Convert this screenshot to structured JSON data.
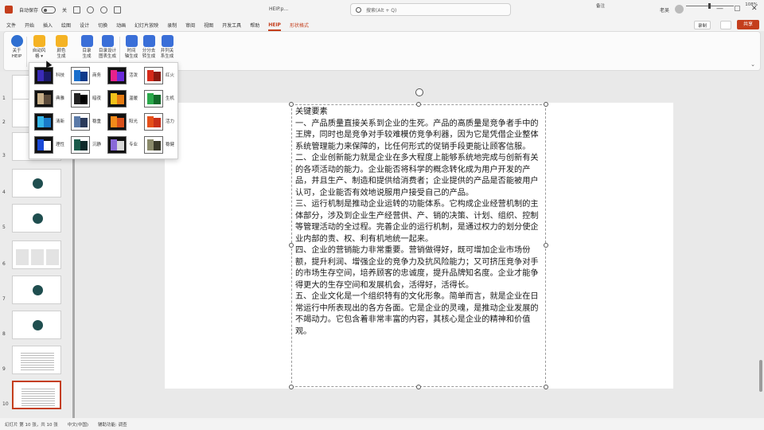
{
  "titlebar": {
    "autosave_label": "自动保存",
    "autosave_state": "关",
    "doc_title": "HEIP.p...",
    "search_placeholder": "搜索(Alt + Q)",
    "user_name": "老吴",
    "minimize": "—",
    "maximize": "▢",
    "close": "✕"
  },
  "menu": {
    "items": [
      "文件",
      "开始",
      "插入",
      "绘图",
      "设计",
      "切换",
      "动画",
      "幻灯片放映",
      "录制",
      "审阅",
      "视图",
      "开发工具",
      "帮助",
      "HEIP",
      "形状格式"
    ],
    "active_index": 13,
    "contextual_index": 14,
    "record_label": "录制",
    "comment_icon": "comment-icon",
    "share_label": "共享"
  },
  "ribbon": {
    "buttons": [
      {
        "label": "关于\nHEIP",
        "icon": "heip-logo-icon",
        "color": "#2f6fd1"
      },
      {
        "label": "自动风\n格 ▾",
        "icon": "paint-bucket-icon",
        "color": "#f5b324"
      },
      {
        "label": "颜色\n生成",
        "icon": "layers-icon",
        "color": "#f5b324"
      },
      {
        "label": "目录\n生成",
        "icon": "list-icon",
        "color": "#3a6fd8"
      },
      {
        "label": "目录设计\n图表生成",
        "icon": "grid-list-icon",
        "color": "#3a6fd8"
      },
      {
        "label": "时间\n轴生成",
        "icon": "wave-icon",
        "color": "#3a6fd8"
      },
      {
        "label": "分分去\n转生成",
        "icon": "network-icon",
        "color": "#3a6fd8"
      },
      {
        "label": "并列关\n系生成",
        "icon": "grid-icon",
        "color": "#3a6fd8"
      }
    ]
  },
  "themes": [
    {
      "name": "科技",
      "frame": "#111111",
      "c1": "#3a2bb8",
      "c2": "#1a1a66"
    },
    {
      "name": "商务",
      "frame": "#ffffff",
      "c1": "#1a6fcc",
      "c2": "#0f3a8a"
    },
    {
      "name": "活泼",
      "frame": "#111111",
      "c1": "#e6228a",
      "c2": "#6a2bd8"
    },
    {
      "name": "红火",
      "frame": "#ffffff",
      "c1": "#d62a1a",
      "c2": "#8a1a10"
    },
    {
      "name": "典雅",
      "frame": "#111111",
      "c1": "#c8b08a",
      "c2": "#5a4a3a"
    },
    {
      "name": "暗夜",
      "frame": "#ffffff",
      "c1": "#222222",
      "c2": "#000000"
    },
    {
      "name": "温暖",
      "frame": "#111111",
      "c1": "#f2c21a",
      "c2": "#e67b12"
    },
    {
      "name": "生机",
      "frame": "#ffffff",
      "c1": "#2aa84a",
      "c2": "#126a2a"
    },
    {
      "name": "清新",
      "frame": "#111111",
      "c1": "#36b6e8",
      "c2": "#1a7ac8"
    },
    {
      "name": "稳重",
      "frame": "#ffffff",
      "c1": "#5a7aa8",
      "c2": "#2a3a5a"
    },
    {
      "name": "阳光",
      "frame": "#111111",
      "c1": "#f28a1a",
      "c2": "#d8501a"
    },
    {
      "name": "活力",
      "frame": "#ffffff",
      "c1": "#e6501a",
      "c2": "#c8301a"
    },
    {
      "name": "理性",
      "frame": "#111111",
      "c1": "#1a4ad8",
      "c2": "#ffffff"
    },
    {
      "name": "沉静",
      "frame": "#ffffff",
      "c1": "#1a5a4a",
      "c2": "#0f2a2a"
    },
    {
      "name": "专业",
      "frame": "#111111",
      "c1": "#8a6ad8",
      "c2": "#d8d8d8"
    },
    {
      "name": "稳健",
      "frame": "#ffffff",
      "c1": "#8a8a6a",
      "c2": "#3a3a2a"
    }
  ],
  "thumbnails": [
    {
      "num": "1",
      "kind": "blank"
    },
    {
      "num": "2",
      "kind": "blank"
    },
    {
      "num": "3",
      "kind": "blank"
    },
    {
      "num": "4",
      "kind": "ring"
    },
    {
      "num": "5",
      "kind": "ring"
    },
    {
      "num": "6",
      "kind": "boxes"
    },
    {
      "num": "7",
      "kind": "ring"
    },
    {
      "num": "8",
      "kind": "ring"
    },
    {
      "num": "9",
      "kind": "lines"
    },
    {
      "num": "10",
      "kind": "lines"
    }
  ],
  "slide": {
    "paragraphs": [
      "关键要素",
      "一、产品质量直接关系到企业的生死。产品的高质量是竞争者手中的王牌，同时也是竞争对手较难模仿竞争利器，因为它是凭借企业整体系统管理能力来保障的，比任何形式的促销手段更能让顾客信服。",
      "二、企业创新能力就是企业在多大程度上能够系统地完成与创新有关的各项活动的能力。企业能否将科学的概念转化成为用户开发的产品，并且生产、制造和提供给消费者；企业提供的产品是否能被用户认可，企业能否有效地说服用户接受自己的产品。",
      "三、运行机制是推动企业运转的功能体系。它构成企业经营机制的主体部分，涉及到企业生产经营供、产、销的决策、计划、组织、控制等管理活动的全过程。完善企业的运行机制，是通过权力的划分使企业内部的责、权、利有机地统一起来。",
      "四、企业的营销能力非常重要。营销做得好，既可增加企业市场份额，提升利润、增强企业的竞争力及抗风险能力；又可挤压竞争对手的市场生存空间，培养顾客的忠诚度，提升品牌知名度。企业才能争得更大的生存空间和发展机会，活得好，活得长。",
      "五、企业文化是一个组织特有的文化形象。简单而言，就是企业在日常运行中所表现出的各方各面。它是企业的灵魂，是推动企业发展的不竭动力。它包含着非常丰富的内容，其核心是企业的精神和价值观。"
    ]
  },
  "statusbar": {
    "slide_info": "幻灯片 第 10 张，共 10 张",
    "language": "中文(中国)",
    "accessibility": "辅助功能: 调查",
    "notes": "备注",
    "zoom": "108%"
  },
  "colors": {
    "accent": "#c43e1c"
  }
}
